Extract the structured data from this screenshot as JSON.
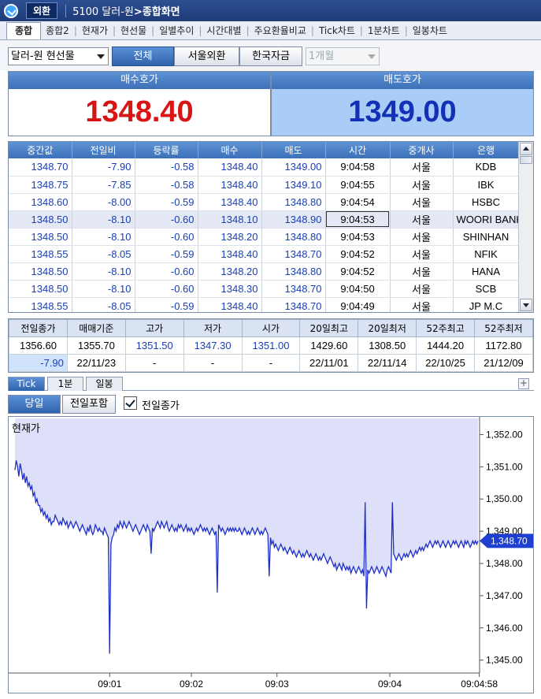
{
  "window": {
    "badge": "외환",
    "screen_code": "5100 달러-원",
    "screen_name": "종합화면"
  },
  "tabs": [
    "종합",
    "종합2",
    "현재가",
    "현선물",
    "일별추이",
    "시간대별",
    "주요환율비교",
    "Tick차트",
    "1분차트",
    "일봉차트"
  ],
  "controls": {
    "instrument": "달러-원 현선물",
    "filters": [
      "전체",
      "서울외환",
      "한국자금"
    ],
    "period": "1개월"
  },
  "quote": {
    "bid_label": "매수호가",
    "bid_price": "1348.40",
    "ask_label": "매도호가",
    "ask_price": "1349.00"
  },
  "trades": {
    "columns": [
      "중간값",
      "전일비",
      "등락률",
      "매수",
      "매도",
      "시간",
      "중개사",
      "은행"
    ],
    "rows": [
      [
        "1348.70",
        "-7.90",
        "-0.58",
        "1348.40",
        "1349.00",
        "9:04:58",
        "서울",
        "KDB"
      ],
      [
        "1348.75",
        "-7.85",
        "-0.58",
        "1348.40",
        "1349.10",
        "9:04:55",
        "서울",
        "IBK"
      ],
      [
        "1348.60",
        "-8.00",
        "-0.59",
        "1348.40",
        "1348.80",
        "9:04:54",
        "서울",
        "HSBC"
      ],
      [
        "1348.50",
        "-8.10",
        "-0.60",
        "1348.10",
        "1348.90",
        "9:04:53",
        "서울",
        "WOORI BANK"
      ],
      [
        "1348.50",
        "-8.10",
        "-0.60",
        "1348.20",
        "1348.80",
        "9:04:53",
        "서울",
        "SHINHAN"
      ],
      [
        "1348.55",
        "-8.05",
        "-0.59",
        "1348.40",
        "1348.70",
        "9:04:52",
        "서울",
        "NFIK"
      ],
      [
        "1348.50",
        "-8.10",
        "-0.60",
        "1348.20",
        "1348.80",
        "9:04:52",
        "서울",
        "HANA"
      ],
      [
        "1348.50",
        "-8.10",
        "-0.60",
        "1348.30",
        "1348.70",
        "9:04:50",
        "서울",
        "SCB"
      ],
      [
        "1348.55",
        "-8.05",
        "-0.59",
        "1348.40",
        "1348.70",
        "9:04:49",
        "서울",
        "JP M.C"
      ]
    ]
  },
  "summary": {
    "headers": [
      "전일종가",
      "매매기준",
      "고가",
      "저가",
      "시가",
      "20일최고",
      "20일최저",
      "52주최고",
      "52주최저"
    ],
    "values": [
      "1356.60",
      "1355.70",
      "1351.50",
      "1347.30",
      "1351.00",
      "1429.60",
      "1308.50",
      "1444.20",
      "1172.80"
    ],
    "dates": [
      "-7.90",
      "22/11/23",
      "-",
      "-",
      "-",
      "22/11/01",
      "22/11/14",
      "22/10/25",
      "21/12/09"
    ]
  },
  "chart_tabs": [
    "Tick",
    "1분",
    "일봉"
  ],
  "chart_controls": {
    "today": "당일",
    "include_prev": "전일포함",
    "prev_close_label": "전일종가",
    "prev_close_checked": true
  },
  "colors": {
    "bid": "#d81414",
    "ask": "#1230b8",
    "header_blue": "#3c70b8",
    "line": "#1e2fc8",
    "fill": "#dde0f8"
  },
  "chart_data": {
    "type": "area",
    "title": "현재가",
    "ylim": [
      1344.6,
      1352.5
    ],
    "y_ticks": [
      "1,352.00",
      "1,351.00",
      "1,350.00",
      "1,349.00",
      "1,348.00",
      "1,347.00",
      "1,346.00",
      "1,345.00"
    ],
    "y_tick_values": [
      1352,
      1351,
      1350,
      1349,
      1348,
      1347,
      1346,
      1345
    ],
    "x_ticks": [
      "09:01",
      "09:02",
      "09:03",
      "09:04",
      "09:04:58"
    ],
    "x_tick_index": [
      73,
      136,
      202,
      289,
      358
    ],
    "current_label": "1,348.70",
    "current_value": 1348.7,
    "values": [
      1350.9,
      1351.2,
      1351.0,
      1350.7,
      1351.1,
      1350.9,
      1350.6,
      1350.8,
      1350.5,
      1350.7,
      1350.4,
      1350.5,
      1350.3,
      1350.4,
      1350.1,
      1350.2,
      1349.9,
      1350.0,
      1349.8,
      1349.8,
      1349.6,
      1349.7,
      1349.5,
      1349.6,
      1349.4,
      1349.5,
      1349.3,
      1349.4,
      1349.2,
      1349.3,
      1349.3,
      1349.5,
      1349.4,
      1349.3,
      1349.2,
      1349.3,
      1349.2,
      1349.4,
      1349.3,
      1349.2,
      1349.3,
      1349.1,
      1349.2,
      1349.3,
      1349.2,
      1349.1,
      1349.2,
      1349.3,
      1349.2,
      1349.1,
      1349.0,
      1349.1,
      1349.2,
      1349.1,
      1349.0,
      1348.9,
      1349.1,
      1349.0,
      1349.2,
      1349.0,
      1348.9,
      1349.0,
      1349.2,
      1349.1,
      1349.0,
      1349.1,
      1349.0,
      1349.0,
      1348.9,
      1349.1,
      1349.0,
      1348.9,
      1348.8,
      1345.2,
      1348.6,
      1348.8,
      1348.9,
      1349.1,
      1349.0,
      1349.2,
      1349.1,
      1349.3,
      1349.2,
      1349.1,
      1349.3,
      1349.2,
      1349.1,
      1349.2,
      1349.3,
      1349.2,
      1349.1,
      1349.0,
      1349.1,
      1349.2,
      1349.1,
      1349.0,
      1348.9,
      1349.0,
      1349.1,
      1349.2,
      1349.1,
      1349.0,
      1349.2,
      1349.1,
      1349.0,
      1348.3,
      1349.1,
      1349.0,
      1349.1,
      1349.2,
      1349.3,
      1349.2,
      1349.1,
      1349.3,
      1349.2,
      1349.1,
      1349.2,
      1349.3,
      1349.1,
      1349.0,
      1349.1,
      1349.2,
      1349.1,
      1349.0,
      1349.1,
      1349.0,
      1349.2,
      1349.1,
      1349.2,
      1349.1,
      1349.0,
      1349.1,
      1349.2,
      1349.0,
      1349.1,
      1349.0,
      1349.1,
      1349.0,
      1348.9,
      1349.0,
      1349.1,
      1349.0,
      1349.1,
      1349.2,
      1349.1,
      1349.0,
      1349.1,
      1349.0,
      1349.1,
      1349.0,
      1348.9,
      1349.0,
      1349.1,
      1349.0,
      1348.9,
      1349.0,
      1347.1,
      1349.2,
      1349.1,
      1349.0,
      1349.1,
      1349.0,
      1348.9,
      1349.0,
      1349.1,
      1349.0,
      1349.1,
      1349.0,
      1349.1,
      1349.0,
      1349.1,
      1349.0,
      1349.0,
      1349.1,
      1349.0,
      1348.9,
      1349.0,
      1349.1,
      1349.0,
      1348.9,
      1349.0,
      1348.9,
      1349.0,
      1349.1,
      1349.0,
      1348.9,
      1349.0,
      1349.1,
      1349.0,
      1348.9,
      1349.0,
      1348.9,
      1349.0,
      1349.1,
      1349.0,
      1348.9,
      1347.6,
      1348.8,
      1348.6,
      1348.7,
      1348.5,
      1348.6,
      1348.5,
      1348.4,
      1348.5,
      1348.6,
      1348.5,
      1348.4,
      1348.5,
      1348.4,
      1348.3,
      1348.4,
      1348.5,
      1348.4,
      1348.3,
      1348.4,
      1348.3,
      1348.2,
      1348.3,
      1348.4,
      1348.3,
      1348.2,
      1348.3,
      1348.2,
      1348.3,
      1348.4,
      1348.3,
      1348.2,
      1348.3,
      1348.2,
      1348.1,
      1348.2,
      1348.3,
      1348.2,
      1348.1,
      1348.2,
      1348.1,
      1348.2,
      1348.3,
      1348.2,
      1348.1,
      1348.0,
      1348.1,
      1348.2,
      1348.1,
      1348.0,
      1347.9,
      1348.0,
      1347.8,
      1347.9,
      1348.0,
      1347.9,
      1347.8,
      1348.0,
      1347.9,
      1347.8,
      1347.9,
      1347.8,
      1347.9,
      1347.7,
      1347.8,
      1347.9,
      1347.8,
      1347.7,
      1347.8,
      1347.9,
      1347.8,
      1347.7,
      1347.8,
      1347.6,
      1349.9,
      1346.6,
      1347.8,
      1347.7,
      1347.8,
      1347.9,
      1347.8,
      1347.7,
      1347.8,
      1347.9,
      1347.8,
      1347.7,
      1347.8,
      1347.9,
      1347.8,
      1347.7,
      1347.6,
      1347.8,
      1347.9,
      1347.8,
      1347.7,
      1349.9,
      1348.3,
      1348.2,
      1348.1,
      1348.2,
      1348.3,
      1348.2,
      1348.1,
      1348.2,
      1348.3,
      1348.2,
      1348.3,
      1348.2,
      1348.3,
      1348.4,
      1348.3,
      1348.2,
      1348.3,
      1348.4,
      1348.3,
      1348.4,
      1348.5,
      1348.4,
      1348.5,
      1348.4,
      1348.5,
      1348.6,
      1348.5,
      1348.6,
      1348.7,
      1348.6,
      1348.5,
      1348.6,
      1348.7,
      1348.6,
      1348.7,
      1348.6,
      1348.5,
      1348.6,
      1348.7,
      1348.6,
      1348.5,
      1348.6,
      1348.7,
      1348.6,
      1348.5,
      1348.6,
      1348.7,
      1348.6,
      1348.7,
      1348.6,
      1348.5,
      1348.6,
      1348.7,
      1348.6,
      1348.5,
      1348.7,
      1348.6,
      1348.7,
      1348.6,
      1348.5,
      1348.6,
      1348.7,
      1348.6,
      1348.7,
      1348.6,
      1348.7
    ]
  }
}
